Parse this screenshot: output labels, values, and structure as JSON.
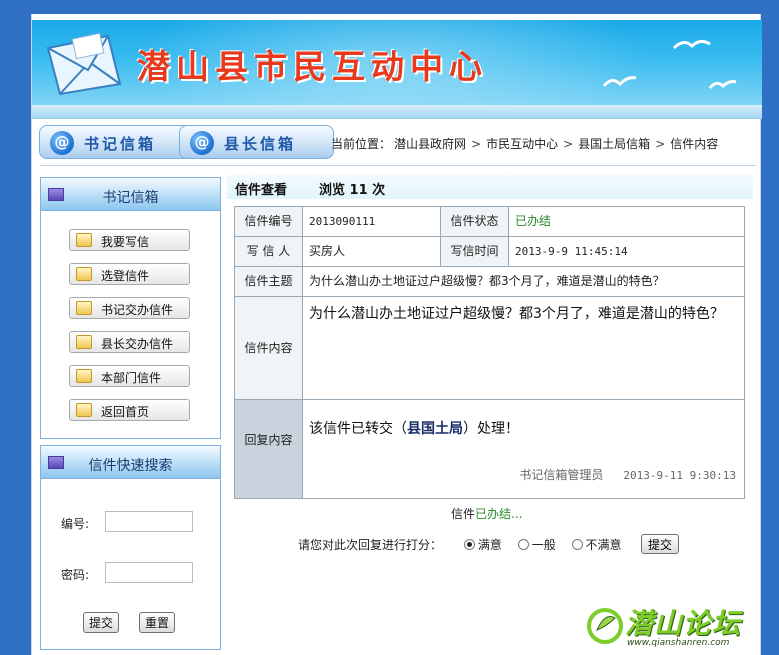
{
  "header": {
    "site_title": "潜山县市民互动中心"
  },
  "nav": {
    "tabs": [
      {
        "label": "书记信箱",
        "icon": "at-icon"
      },
      {
        "label": "县长信箱",
        "icon": "at-icon"
      }
    ],
    "breadcrumb_prefix": "当前位置：",
    "breadcrumb": [
      "潜山县政府网",
      "市民互动中心",
      "县国土局信箱",
      "信件内容"
    ],
    "separator": ">"
  },
  "sidebar": {
    "mailbox_title": "书记信箱",
    "menu": [
      {
        "label": "我要写信",
        "icon": "write-mail-icon"
      },
      {
        "label": "选登信件",
        "icon": "selected-letters-icon"
      },
      {
        "label": "书记交办信件",
        "icon": "assigned-letters-icon"
      },
      {
        "label": "县长交办信件",
        "icon": "mayor-assigned-icon"
      },
      {
        "label": "本部门信件",
        "icon": "department-letters-icon"
      },
      {
        "label": "返回首页",
        "icon": "home-icon"
      }
    ],
    "search_title": "信件快速搜索",
    "number_label": "编号:",
    "password_label": "密码:",
    "number_value": "",
    "password_value": "",
    "submit_label": "提交",
    "reset_label": "重置"
  },
  "letter": {
    "title": "信件查看",
    "views_text": "浏览 11 次",
    "number_label": "信件编号",
    "number": "2013090111",
    "status_label": "信件状态",
    "status": "已办结",
    "writer_label": "写 信 人",
    "writer": "买房人",
    "time_label": "写信时间",
    "time": "2013-9-9 11:45:14",
    "subject_label": "信件主题",
    "subject": "为什么潜山办土地证过户超级慢？都3个月了，难道是潜山的特色？",
    "content_label": "信件内容",
    "content": "为什么潜山办土地证过户超级慢？都3个月了，难道是潜山的特色？",
    "reply_label": "回复内容",
    "reply_prefix": "该信件已转交（",
    "reply_dept": "县国土局",
    "reply_suffix": "）处理！",
    "reply_by": "书记信箱管理员",
    "reply_time": "2013-9-11 9:30:13"
  },
  "status_line": {
    "prefix": "信件",
    "status": "已办结..."
  },
  "rating": {
    "prompt": "请您对此次回复进行打分：",
    "options": [
      "满意",
      "一般",
      "不满意"
    ],
    "selected": "满意",
    "submit_label": "提交"
  },
  "watermark": {
    "text": "潜山论坛",
    "url": "www.qianshanren.com"
  },
  "colors": {
    "page_bg": "#2f6fc4",
    "banner": "#1aa9e8",
    "title_red": "#e8391c",
    "status_green": "#2a8a2a"
  }
}
